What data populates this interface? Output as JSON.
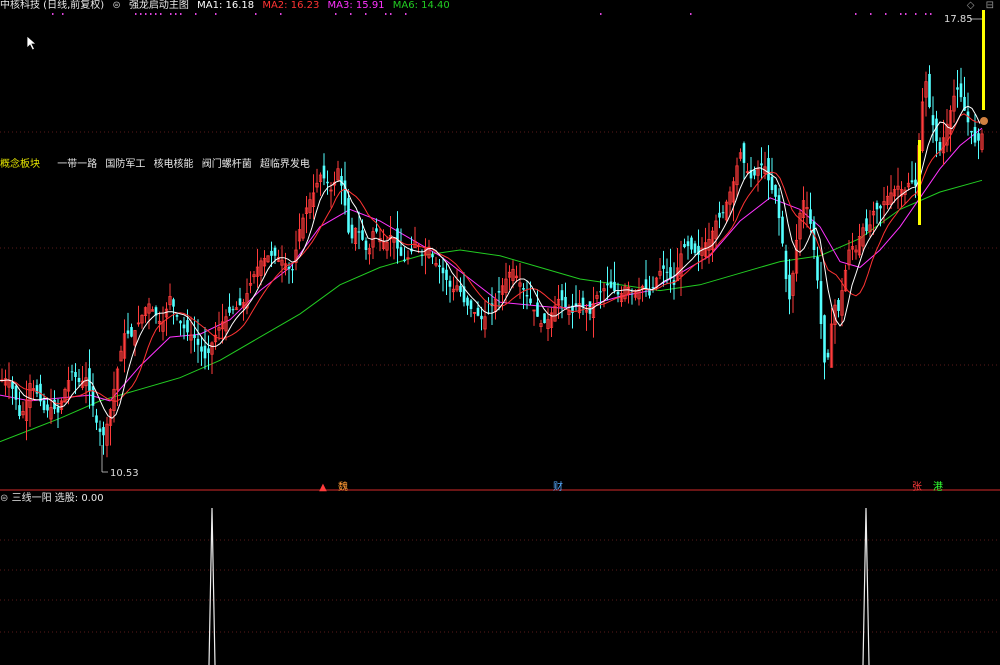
{
  "header": {
    "stock": "中核科技 (日线,前复权)",
    "indicator": "强龙启动主图",
    "ma1": "MA1: 16.18",
    "ma2": "MA2: 16.23",
    "ma3": "MA3: 15.91",
    "ma6": "MA6: 14.40",
    "icons": "◇ ⊟"
  },
  "concept": {
    "title": "概念板块",
    "tags": [
      "一带一路",
      "国防军工",
      "核电核能",
      "阀门螺杆菌",
      "超临界发电"
    ]
  },
  "lower_panel": {
    "title": "三线一阳",
    "value_label": "选股: 0.00"
  },
  "colors": {
    "up": "#ff3b3b",
    "down": "#53ffff",
    "ma1": "#ffffff",
    "ma2": "#ff3333",
    "ma3": "#ff33ff",
    "ma6": "#22cc22",
    "bar_yellow": "#ffff00"
  },
  "chart_data": {
    "type": "candlestick",
    "price_range": [
      10.0,
      18.2
    ],
    "annotations": {
      "high": "17.85",
      "low": "10.53"
    },
    "markers": [
      {
        "label": "▲",
        "color": "#ff3b3b"
      },
      {
        "label": "魏",
        "color": "#ff9933"
      },
      {
        "label": "财",
        "color": "#55aaff"
      },
      {
        "label": "张",
        "color": "#ff3b3b"
      },
      {
        "label": "港",
        "color": "#33ff33"
      }
    ],
    "lower_spikes": [
      {
        "value": 1.0
      },
      {
        "value": 1.0
      }
    ],
    "close_path": [
      [
        0,
        11.85
      ],
      [
        8,
        11.9
      ],
      [
        15,
        11.6
      ],
      [
        20,
        11.2
      ],
      [
        25,
        11.4
      ],
      [
        30,
        11.8
      ],
      [
        38,
        11.6
      ],
      [
        45,
        11.3
      ],
      [
        52,
        11.4
      ],
      [
        58,
        11.3
      ],
      [
        65,
        11.7
      ],
      [
        72,
        12.0
      ],
      [
        80,
        11.8
      ],
      [
        86,
        11.9
      ],
      [
        92,
        11.5
      ],
      [
        98,
        11.0
      ],
      [
        104,
        10.9
      ],
      [
        110,
        11.3
      ],
      [
        118,
        12.1
      ],
      [
        125,
        12.7
      ],
      [
        132,
        12.6
      ],
      [
        140,
        12.9
      ],
      [
        148,
        13.2
      ],
      [
        155,
        13.0
      ],
      [
        162,
        12.8
      ],
      [
        170,
        13.3
      ],
      [
        178,
        12.9
      ],
      [
        186,
        12.7
      ],
      [
        194,
        12.6
      ],
      [
        200,
        12.4
      ],
      [
        206,
        12.2
      ],
      [
        212,
        12.5
      ],
      [
        220,
        12.8
      ],
      [
        228,
        13.0
      ],
      [
        236,
        13.1
      ],
      [
        244,
        13.2
      ],
      [
        252,
        13.6
      ],
      [
        260,
        13.9
      ],
      [
        268,
        14.0
      ],
      [
        276,
        14.0
      ],
      [
        284,
        13.9
      ],
      [
        292,
        13.7
      ],
      [
        300,
        14.5
      ],
      [
        308,
        14.9
      ],
      [
        314,
        15.1
      ],
      [
        320,
        15.4
      ],
      [
        326,
        15.3
      ],
      [
        332,
        15.1
      ],
      [
        338,
        15.5
      ],
      [
        344,
        15.0
      ],
      [
        350,
        14.2
      ],
      [
        356,
        14.5
      ],
      [
        362,
        14.3
      ],
      [
        368,
        14.0
      ],
      [
        374,
        14.5
      ],
      [
        380,
        14.3
      ],
      [
        386,
        14.2
      ],
      [
        392,
        14.4
      ],
      [
        398,
        14.1
      ],
      [
        404,
        13.9
      ],
      [
        410,
        14.0
      ],
      [
        416,
        14.3
      ],
      [
        422,
        14.0
      ],
      [
        428,
        14.2
      ],
      [
        434,
        13.9
      ],
      [
        440,
        13.8
      ],
      [
        446,
        13.6
      ],
      [
        452,
        13.4
      ],
      [
        458,
        13.5
      ],
      [
        464,
        13.2
      ],
      [
        470,
        13.1
      ],
      [
        476,
        13.0
      ],
      [
        482,
        12.9
      ],
      [
        488,
        13.0
      ],
      [
        494,
        13.2
      ],
      [
        500,
        13.4
      ],
      [
        506,
        13.6
      ],
      [
        512,
        13.8
      ],
      [
        518,
        13.6
      ],
      [
        524,
        13.4
      ],
      [
        530,
        13.2
      ],
      [
        536,
        13.0
      ],
      [
        542,
        12.8
      ],
      [
        548,
        12.9
      ],
      [
        554,
        13.1
      ],
      [
        560,
        13.3
      ],
      [
        566,
        13.1
      ],
      [
        572,
        13.0
      ],
      [
        578,
        13.2
      ],
      [
        584,
        13.1
      ],
      [
        590,
        13.0
      ],
      [
        596,
        13.3
      ],
      [
        602,
        13.4
      ],
      [
        608,
        13.5
      ],
      [
        614,
        13.4
      ],
      [
        620,
        13.3
      ],
      [
        626,
        13.5
      ],
      [
        632,
        13.4
      ],
      [
        638,
        13.4
      ],
      [
        644,
        13.5
      ],
      [
        650,
        13.3
      ],
      [
        656,
        13.6
      ],
      [
        662,
        13.8
      ],
      [
        668,
        13.7
      ],
      [
        674,
        13.5
      ],
      [
        680,
        14.0
      ],
      [
        686,
        14.2
      ],
      [
        692,
        14.1
      ],
      [
        698,
        14.0
      ],
      [
        704,
        14.2
      ],
      [
        710,
        14.3
      ],
      [
        716,
        14.6
      ],
      [
        722,
        14.7
      ],
      [
        728,
        15.0
      ],
      [
        734,
        15.3
      ],
      [
        740,
        15.8
      ],
      [
        746,
        15.5
      ],
      [
        752,
        15.3
      ],
      [
        758,
        15.5
      ],
      [
        764,
        15.6
      ],
      [
        770,
        15.2
      ],
      [
        776,
        15.0
      ],
      [
        782,
        14.3
      ],
      [
        786,
        13.6
      ],
      [
        790,
        13.2
      ],
      [
        796,
        14.2
      ],
      [
        802,
        15.0
      ],
      [
        808,
        14.8
      ],
      [
        812,
        14.4
      ],
      [
        818,
        13.5
      ],
      [
        822,
        12.6
      ],
      [
        826,
        11.9
      ],
      [
        830,
        12.6
      ],
      [
        834,
        13.2
      ],
      [
        838,
        13.0
      ],
      [
        844,
        13.6
      ],
      [
        850,
        14.2
      ],
      [
        856,
        14.1
      ],
      [
        862,
        14.5
      ],
      [
        868,
        14.4
      ],
      [
        874,
        14.8
      ],
      [
        880,
        14.8
      ],
      [
        886,
        15.0
      ],
      [
        892,
        15.1
      ],
      [
        898,
        15.2
      ],
      [
        904,
        15.1
      ],
      [
        910,
        15.3
      ],
      [
        916,
        15.2
      ],
      [
        922,
        16.6
      ],
      [
        926,
        17.0
      ],
      [
        930,
        16.5
      ],
      [
        936,
        16.0
      ],
      [
        940,
        15.8
      ],
      [
        946,
        16.2
      ],
      [
        952,
        16.6
      ],
      [
        956,
        16.9
      ],
      [
        960,
        16.8
      ],
      [
        966,
        16.4
      ],
      [
        970,
        16.2
      ],
      [
        976,
        15.9
      ],
      [
        982,
        16.1
      ]
    ],
    "ma3_path": [
      [
        0,
        11.6
      ],
      [
        30,
        11.5
      ],
      [
        60,
        11.55
      ],
      [
        90,
        11.6
      ],
      [
        110,
        11.5
      ],
      [
        140,
        12.1
      ],
      [
        170,
        12.6
      ],
      [
        200,
        12.65
      ],
      [
        230,
        12.9
      ],
      [
        260,
        13.4
      ],
      [
        290,
        13.8
      ],
      [
        320,
        14.5
      ],
      [
        350,
        14.8
      ],
      [
        380,
        14.6
      ],
      [
        410,
        14.3
      ],
      [
        440,
        14.0
      ],
      [
        470,
        13.6
      ],
      [
        500,
        13.2
      ],
      [
        530,
        13.15
      ],
      [
        560,
        13.1
      ],
      [
        590,
        13.15
      ],
      [
        620,
        13.3
      ],
      [
        650,
        13.4
      ],
      [
        680,
        13.7
      ],
      [
        710,
        14.0
      ],
      [
        740,
        14.6
      ],
      [
        770,
        15.0
      ],
      [
        800,
        14.8
      ],
      [
        820,
        14.5
      ],
      [
        840,
        13.9
      ],
      [
        860,
        13.8
      ],
      [
        880,
        14.1
      ],
      [
        900,
        14.5
      ],
      [
        920,
        15.0
      ],
      [
        940,
        15.5
      ],
      [
        960,
        15.9
      ],
      [
        982,
        16.2
      ]
    ],
    "ma6_path": [
      [
        0,
        10.8
      ],
      [
        30,
        11.0
      ],
      [
        60,
        11.2
      ],
      [
        100,
        11.5
      ],
      [
        140,
        11.7
      ],
      [
        180,
        11.9
      ],
      [
        220,
        12.2
      ],
      [
        260,
        12.6
      ],
      [
        300,
        13.0
      ],
      [
        340,
        13.5
      ],
      [
        380,
        13.8
      ],
      [
        420,
        14.0
      ],
      [
        460,
        14.1
      ],
      [
        500,
        14.0
      ],
      [
        540,
        13.8
      ],
      [
        580,
        13.6
      ],
      [
        620,
        13.5
      ],
      [
        660,
        13.4
      ],
      [
        700,
        13.5
      ],
      [
        740,
        13.7
      ],
      [
        780,
        13.9
      ],
      [
        820,
        14.0
      ],
      [
        860,
        14.3
      ],
      [
        900,
        14.8
      ],
      [
        940,
        15.1
      ],
      [
        982,
        15.3
      ]
    ]
  }
}
